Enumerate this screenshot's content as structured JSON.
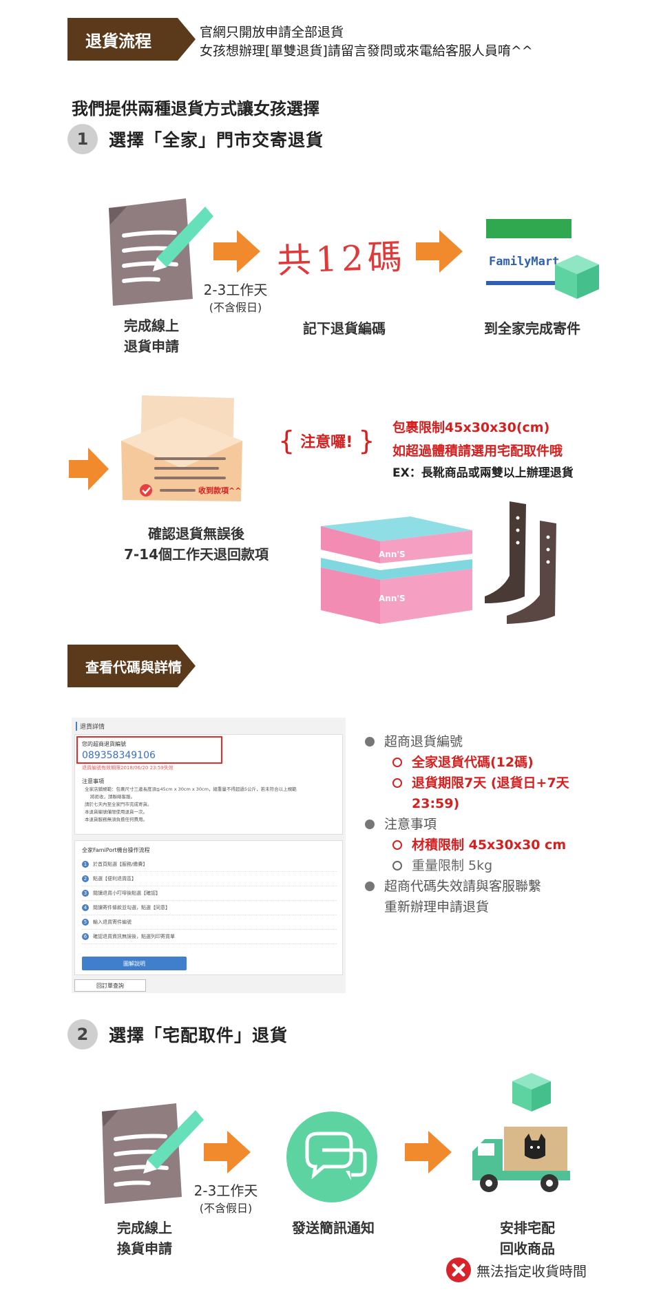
{
  "header": {
    "tag_label": "退貨流程",
    "intro_lines": [
      "官網只開放申請全部退貨",
      "女孩想辦理[單雙退貨]請留言發問或來電給客服人員唷^^"
    ]
  },
  "lead": "我們提供兩種退貨方式讓女孩選擇",
  "step1": {
    "num": "1",
    "title": "選擇「全家」門市交寄退貨",
    "days": "2-3工作天",
    "days_sub": "(不含假日)",
    "handwriting": "共12碼",
    "familymart_logo": "FamilyMart",
    "caption_apply": [
      "完成線上",
      "退貨申請"
    ],
    "caption_code": "記下退貨編碼",
    "caption_send": "到全家完成寄件",
    "refund_stamp": "收到款項^^",
    "caption_refund": [
      "確認退貨無誤後",
      "7-14個工作天退回款項"
    ],
    "attention_label": "注意囉!",
    "attention_lines": [
      "包裹限制45x30x30(cm)",
      "如超過體積請選用宅配取件哦"
    ],
    "attention_ex": "EX：長靴商品或兩雙以上辦理退貨",
    "box_brand": "Ann'S"
  },
  "details": {
    "tag_label": "查看代碼與詳情",
    "panel": {
      "title": "退貨詳情",
      "code_label": "您的超商退貨編號",
      "code_value": "089358349106",
      "deadline": "退貨編號有效期限2018/06/20 23:59失效",
      "notes_title": "注意事項",
      "notes": [
        "全家店鋪規範：包裹尺寸三邊長度須≦45cm x 30cm x 30cm，總重量不得超過5公斤，若未符合以上規範",
        "將拒收，請聯絡客服。",
        "請於七天內至全家門市完成寄貨。",
        "本退貨編號僅限使用退貨一次。",
        "本退貨服務無須負擔任何費用。"
      ],
      "famiport_title": "全家FamiPort機台操作流程",
      "famiport_steps": [
        "於首頁點選【服務/繳費】",
        "點選【便利退貨區】",
        "閱讀退貨小叮嚀後點選【確認】",
        "閱讀寄件條款並勾選，點選【同意】",
        "輸入退貨寄件編號",
        "確認退貨資訊無誤後，點選列印寄貨單"
      ],
      "illustrate_button": "圖解說明",
      "back_button": "回訂單查詢"
    },
    "bullets": [
      {
        "text": "超商退貨編號",
        "sub": [
          {
            "text": "全家退貨代碼(12碼)",
            "tone": "red"
          },
          {
            "text": "退貨期限7天 (退貨日+7天",
            "tone": "red"
          },
          {
            "text": "23:59)",
            "tone": "red"
          }
        ]
      },
      {
        "text": "注意事項",
        "sub": [
          {
            "text": "材積限制 45x30x30 cm",
            "tone": "red"
          },
          {
            "text": "重量限制 5kg",
            "tone": "grey"
          }
        ]
      },
      {
        "text": "超商代碼失效請與客服聯繫",
        "sub": []
      },
      {
        "text": "重新辦理申請退貨",
        "sub": []
      }
    ]
  },
  "step2": {
    "num": "2",
    "title": "選擇「宅配取件」退貨",
    "days": "2-3工作天",
    "days_sub": "(不含假日)",
    "caption_apply": [
      "完成線上",
      "換貨申請"
    ],
    "caption_sms": "發送簡訊通知",
    "caption_pickup": [
      "安排宅配",
      "回收商品"
    ],
    "warning": "無法指定收貨時間"
  },
  "colors": {
    "tag_brown": "#5b3a1c",
    "accent_red": "#d61f1f",
    "arrow_orange": "#f08a2c",
    "mint": "#5ed3a2",
    "fm_green": "#2fa84f",
    "fm_blue": "#2f5fb3",
    "box_pink": "#f28cb3",
    "box_cyan": "#7fd7e0"
  }
}
